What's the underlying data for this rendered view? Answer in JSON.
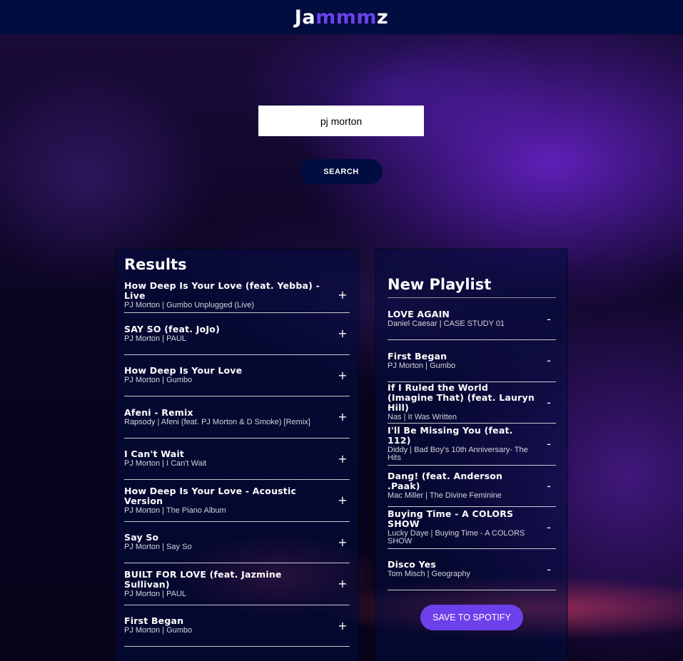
{
  "header": {
    "logo_prefix": "Ja",
    "logo_accent": "mmm",
    "logo_suffix": "z",
    "accent_color": "#6c41ec",
    "background_color": "#010c3f"
  },
  "search": {
    "value": "pj morton",
    "button_label": "SEARCH"
  },
  "results": {
    "title": "Results",
    "add_symbol": "+",
    "tracks": [
      {
        "name": "How Deep Is Your Love (feat. Yebba) - Live",
        "meta": "PJ Morton | Gumbo Unplugged (Live)"
      },
      {
        "name": "SAY SO (feat. JoJo)",
        "meta": "PJ Morton | PAUL"
      },
      {
        "name": "How Deep Is Your Love",
        "meta": "PJ Morton | Gumbo"
      },
      {
        "name": "Afeni - Remix",
        "meta": "Rapsody | Afeni (feat. PJ Morton & D Smoke) [Remix]"
      },
      {
        "name": "I Can't Wait",
        "meta": "PJ Morton | I Can't Wait"
      },
      {
        "name": "How Deep Is Your Love - Acoustic Version",
        "meta": "PJ Morton | The Piano Album"
      },
      {
        "name": "Say So",
        "meta": "PJ Morton | Say So"
      },
      {
        "name": "BUILT FOR LOVE (feat. Jazmine Sullivan)",
        "meta": "PJ Morton | PAUL"
      },
      {
        "name": "First Began",
        "meta": "PJ Morton | Gumbo"
      }
    ]
  },
  "playlist": {
    "title": "New Playlist",
    "remove_symbol": "-",
    "save_label": "SAVE TO SPOTIFY",
    "tracks": [
      {
        "name": "LOVE AGAIN",
        "meta": "Daniel Caesar | CASE STUDY 01"
      },
      {
        "name": "First Began",
        "meta": "PJ Morton | Gumbo"
      },
      {
        "name": "If I Ruled the World (Imagine That) (feat. Lauryn Hill)",
        "meta": "Nas | It Was Written"
      },
      {
        "name": "I'll Be Missing You (feat. 112)",
        "meta": "Diddy | Bad Boy's 10th Anniversary- The Hits"
      },
      {
        "name": "Dang! (feat. Anderson .Paak)",
        "meta": "Mac Miller | The Divine Feminine"
      },
      {
        "name": "Buying Time - A COLORS SHOW",
        "meta": "Lucky Daye | Buying Time - A COLORS SHOW"
      },
      {
        "name": "Disco Yes",
        "meta": "Tom Misch | Geography"
      }
    ]
  }
}
